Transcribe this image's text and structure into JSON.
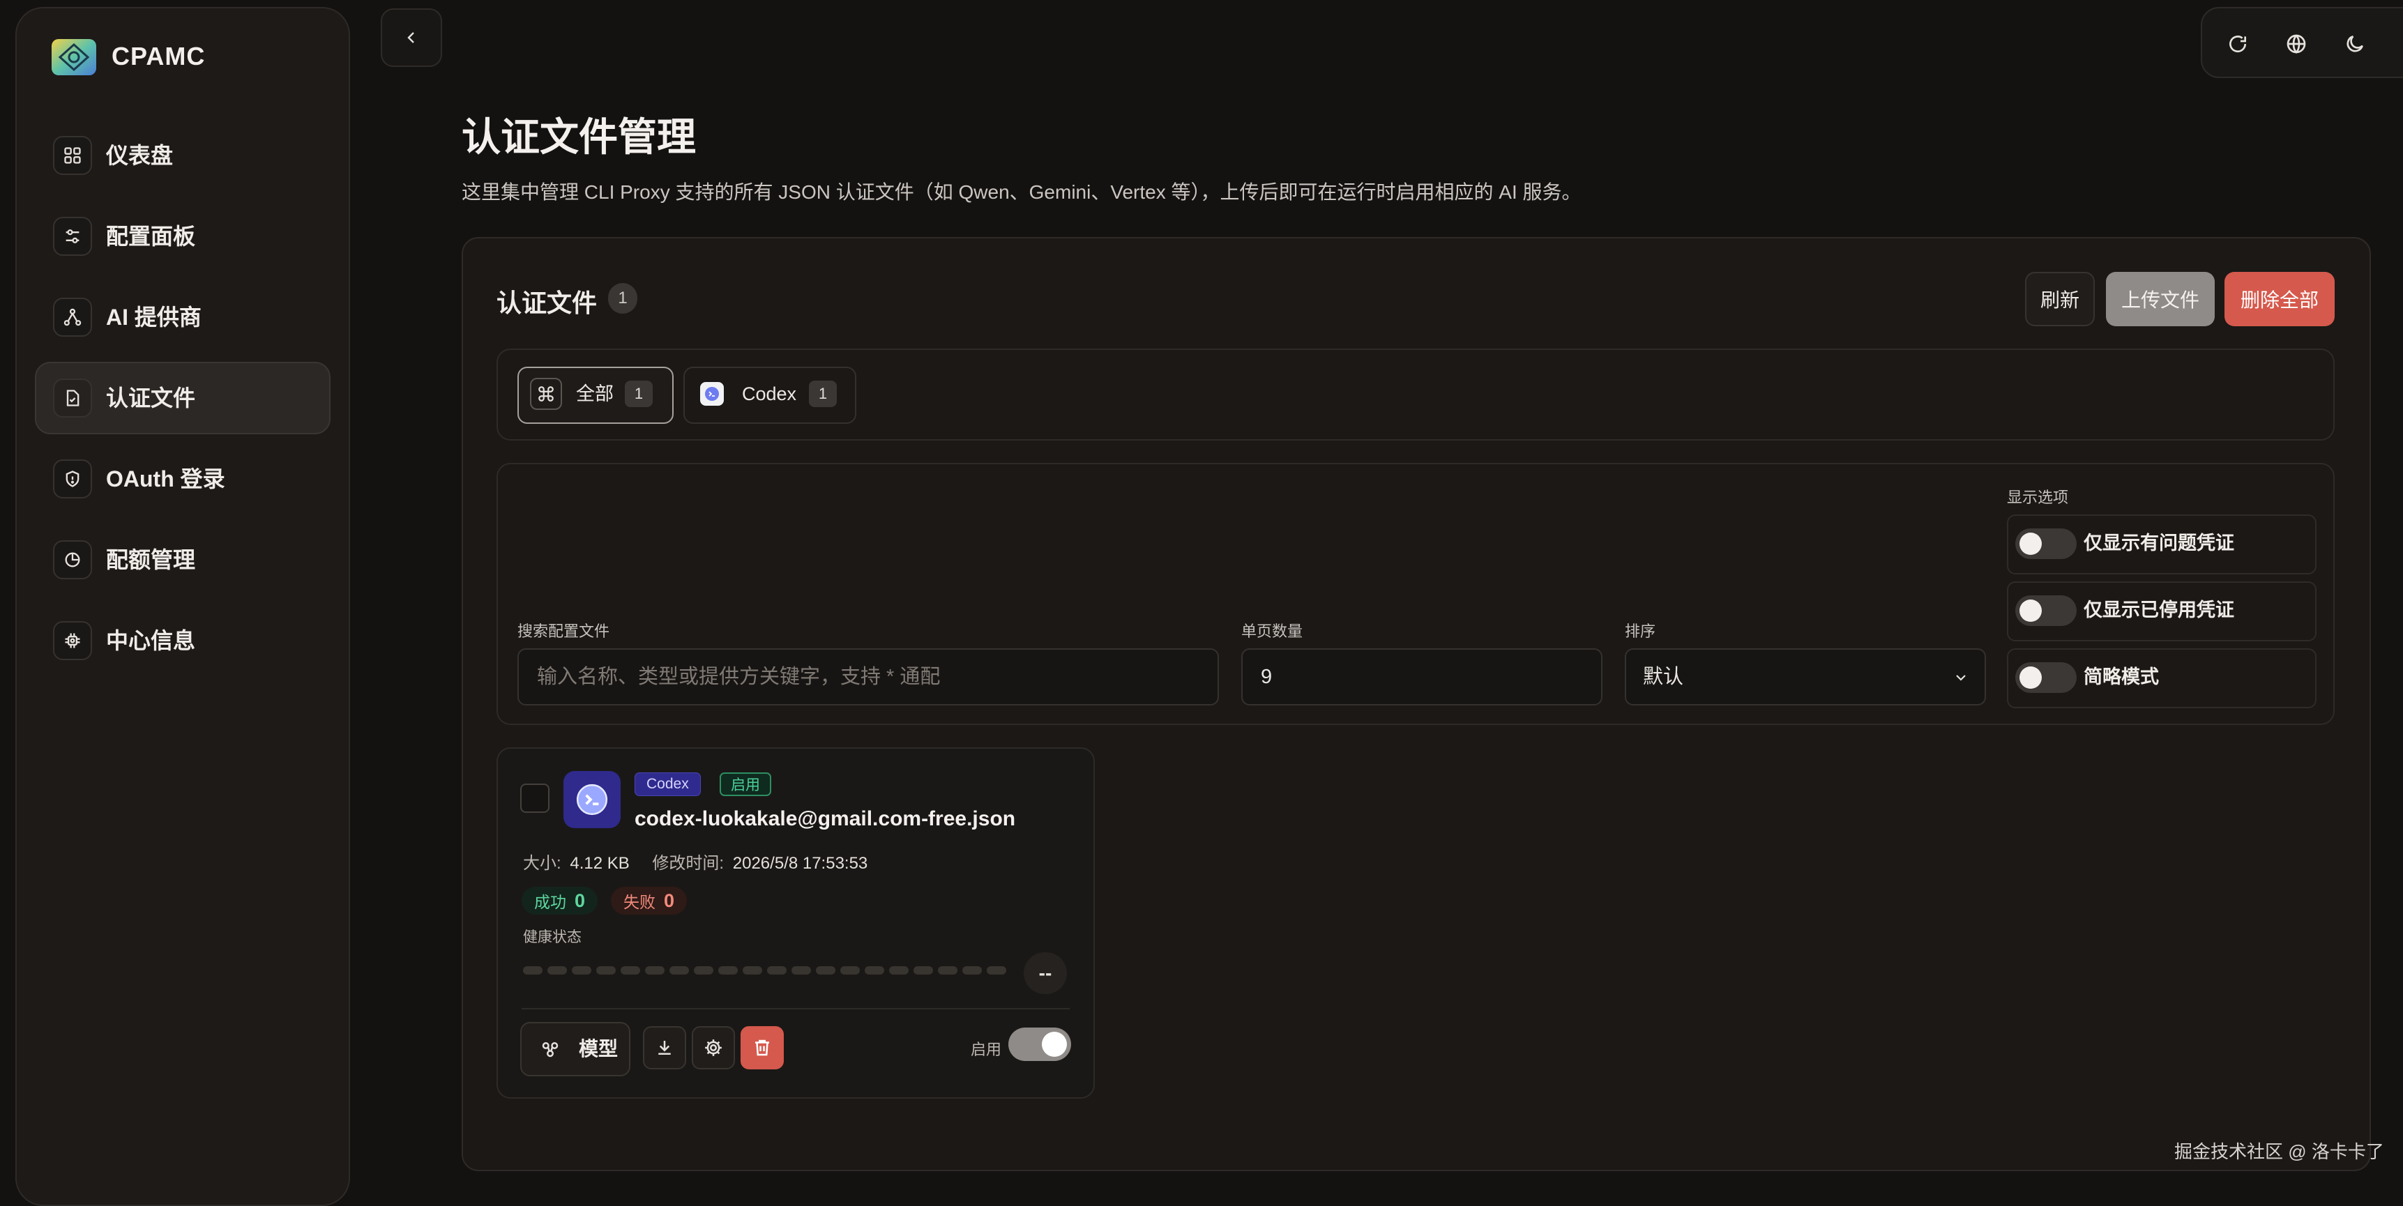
{
  "app": {
    "name": "CPAMC"
  },
  "sidebar": {
    "items": [
      {
        "label": "仪表盘",
        "icon": "dashboard-icon"
      },
      {
        "label": "配置面板",
        "icon": "sliders-icon"
      },
      {
        "label": "AI 提供商",
        "icon": "network-icon"
      },
      {
        "label": "认证文件",
        "icon": "file-check-icon",
        "active": true
      },
      {
        "label": "OAuth 登录",
        "icon": "shield-icon"
      },
      {
        "label": "配额管理",
        "icon": "pie-chart-icon"
      },
      {
        "label": "中心信息",
        "icon": "chip-icon"
      }
    ]
  },
  "topbar": {
    "icons": [
      "refresh-icon",
      "globe-icon",
      "moon-icon"
    ]
  },
  "page": {
    "title": "认证文件管理",
    "description": "这里集中管理 CLI Proxy 支持的所有 JSON 认证文件（如 Qwen、Gemini、Vertex 等），上传后即可在运行时启用相应的 AI 服务。"
  },
  "files_section": {
    "title": "认证文件",
    "count": "1",
    "buttons": {
      "refresh": "刷新",
      "upload": "上传文件",
      "delete_all": "删除全部"
    }
  },
  "tabs": [
    {
      "label": "全部",
      "count": "1",
      "active": true
    },
    {
      "label": "Codex",
      "count": "1",
      "active": false
    }
  ],
  "filters": {
    "search_label": "搜索配置文件",
    "search_placeholder": "输入名称、类型或提供方关键字，支持 * 通配",
    "page_size_label": "单页数量",
    "page_size_value": "9",
    "sort_label": "排序",
    "sort_value": "默认",
    "display_label": "显示选项",
    "toggles": [
      {
        "label": "仅显示有问题凭证",
        "on": false
      },
      {
        "label": "仅显示已停用凭证",
        "on": false
      },
      {
        "label": "简略模式",
        "on": false
      }
    ]
  },
  "file_card": {
    "provider": "Codex",
    "status": "启用",
    "name": "codex-luokakale@gmail.com-free.json",
    "size_label": "大小:",
    "size": "4.12 KB",
    "modified_label": "修改时间:",
    "modified": "2026/5/8 17:53:53",
    "success_label": "成功",
    "success_count": "0",
    "fail_label": "失败",
    "fail_count": "0",
    "health_label": "健康状态",
    "health_value": "--",
    "models_button": "模型",
    "enable_label": "启用",
    "enabled": true
  },
  "colors": {
    "accent_danger": "#d5594c",
    "success": "#5ed79f",
    "codex": "#2f2b8e"
  },
  "watermark": "掘金技术社区 @ 洛卡卡了"
}
